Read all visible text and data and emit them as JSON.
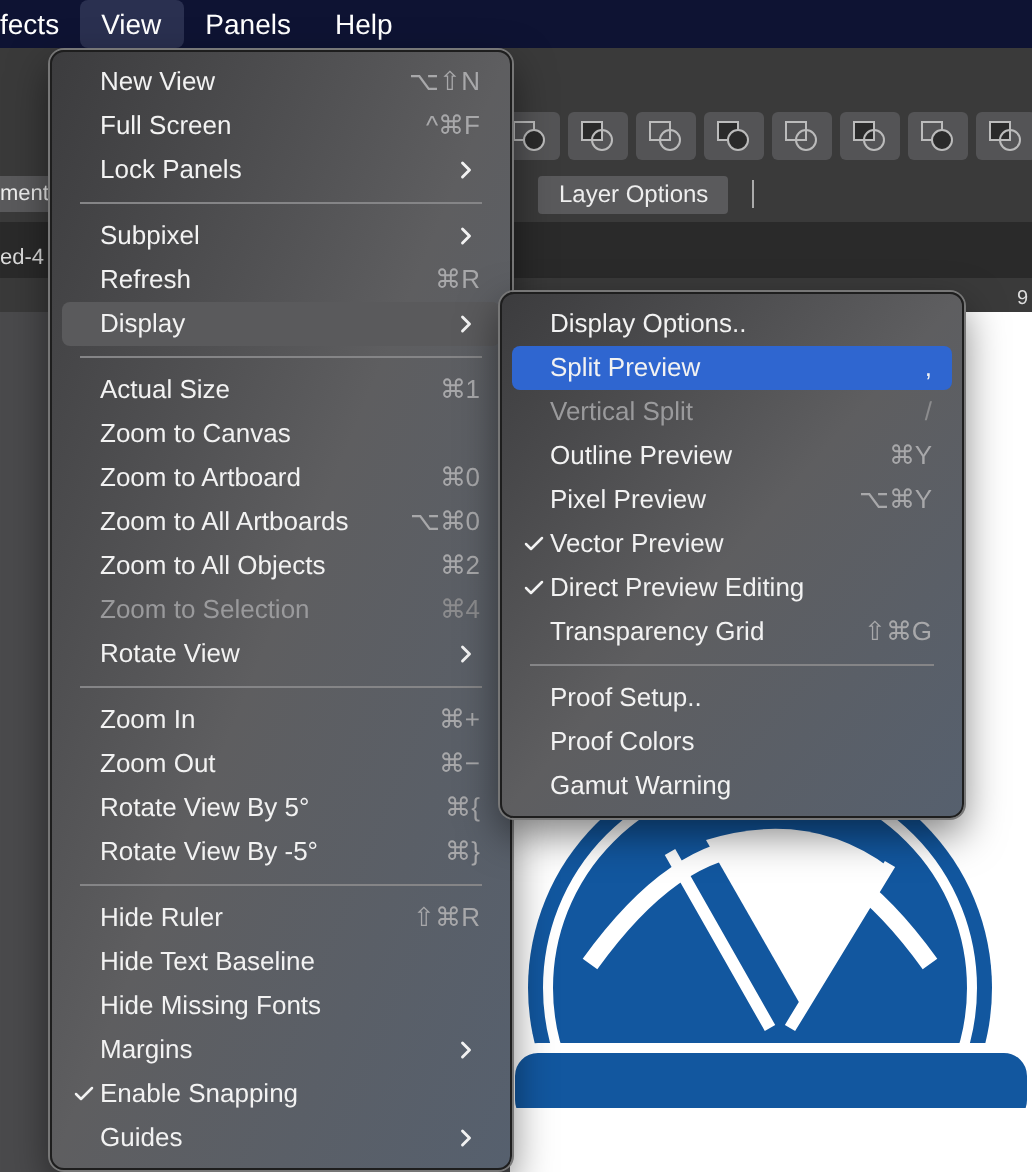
{
  "menu_bar": {
    "items": [
      {
        "label": "fects",
        "selected": false
      },
      {
        "label": "View",
        "selected": true
      },
      {
        "label": "Panels",
        "selected": false
      },
      {
        "label": "Help",
        "selected": false
      }
    ]
  },
  "toolbar": {
    "layer_options_button": "Layer Options",
    "left_tab": "ment",
    "document_tab": "ed-4",
    "ruler_label": "9"
  },
  "view_menu": {
    "groups": [
      [
        {
          "label": "New View",
          "shortcut": "⌥⇧N",
          "submenu": false,
          "checked": false,
          "disabled": false,
          "selected": false
        },
        {
          "label": "Full Screen",
          "shortcut": "^⌘F",
          "submenu": false,
          "checked": false,
          "disabled": false,
          "selected": false
        },
        {
          "label": "Lock Panels",
          "submenu": true,
          "checked": false,
          "disabled": false,
          "selected": false
        }
      ],
      [
        {
          "label": "Subpixel",
          "submenu": true,
          "checked": false,
          "disabled": false,
          "selected": false
        },
        {
          "label": "Refresh",
          "shortcut": "⌘R",
          "submenu": false,
          "checked": false,
          "disabled": false,
          "selected": false
        },
        {
          "label": "Display",
          "submenu": true,
          "checked": false,
          "disabled": false,
          "selected": true
        }
      ],
      [
        {
          "label": "Actual Size",
          "shortcut": "⌘1",
          "submenu": false,
          "checked": false,
          "disabled": false,
          "selected": false
        },
        {
          "label": "Zoom to Canvas",
          "submenu": false,
          "checked": false,
          "disabled": false,
          "selected": false
        },
        {
          "label": "Zoom to Artboard",
          "shortcut": "⌘0",
          "submenu": false,
          "checked": false,
          "disabled": false,
          "selected": false
        },
        {
          "label": "Zoom to All Artboards",
          "shortcut": "⌥⌘0",
          "submenu": false,
          "checked": false,
          "disabled": false,
          "selected": false
        },
        {
          "label": "Zoom to All Objects",
          "shortcut": "⌘2",
          "submenu": false,
          "checked": false,
          "disabled": false,
          "selected": false
        },
        {
          "label": "Zoom to Selection",
          "shortcut": "⌘4",
          "submenu": false,
          "checked": false,
          "disabled": true,
          "selected": false
        },
        {
          "label": "Rotate View",
          "submenu": true,
          "checked": false,
          "disabled": false,
          "selected": false
        }
      ],
      [
        {
          "label": "Zoom In",
          "shortcut": "⌘+",
          "submenu": false,
          "checked": false,
          "disabled": false,
          "selected": false
        },
        {
          "label": "Zoom Out",
          "shortcut": "⌘−",
          "submenu": false,
          "checked": false,
          "disabled": false,
          "selected": false
        },
        {
          "label": "Rotate View By 5°",
          "shortcut": "⌘{",
          "submenu": false,
          "checked": false,
          "disabled": false,
          "selected": false
        },
        {
          "label": "Rotate View By -5°",
          "shortcut": "⌘}",
          "submenu": false,
          "checked": false,
          "disabled": false,
          "selected": false
        }
      ],
      [
        {
          "label": "Hide Ruler",
          "shortcut": "⇧⌘R",
          "submenu": false,
          "checked": false,
          "disabled": false,
          "selected": false
        },
        {
          "label": "Hide Text Baseline",
          "submenu": false,
          "checked": false,
          "disabled": false,
          "selected": false
        },
        {
          "label": "Hide Missing Fonts",
          "submenu": false,
          "checked": false,
          "disabled": false,
          "selected": false
        },
        {
          "label": "Margins",
          "submenu": true,
          "checked": false,
          "disabled": false,
          "selected": false
        },
        {
          "label": "Enable Snapping",
          "submenu": false,
          "checked": true,
          "disabled": false,
          "selected": false
        },
        {
          "label": "Guides",
          "submenu": true,
          "checked": false,
          "disabled": false,
          "selected": false
        }
      ]
    ]
  },
  "display_submenu": {
    "groups": [
      [
        {
          "label": "Display Options..",
          "submenu": false,
          "checked": false,
          "disabled": false,
          "selected": false
        },
        {
          "label": "Split Preview",
          "shortcut": ",",
          "submenu": false,
          "checked": false,
          "disabled": false,
          "selected": true
        },
        {
          "label": "Vertical Split",
          "shortcut": "/",
          "submenu": false,
          "checked": false,
          "disabled": true,
          "selected": false
        },
        {
          "label": "Outline Preview",
          "shortcut": "⌘Y",
          "submenu": false,
          "checked": false,
          "disabled": false,
          "selected": false
        },
        {
          "label": "Pixel Preview",
          "shortcut": "⌥⌘Y",
          "submenu": false,
          "checked": false,
          "disabled": false,
          "selected": false
        },
        {
          "label": "Vector Preview",
          "submenu": false,
          "checked": true,
          "disabled": false,
          "selected": false
        },
        {
          "label": "Direct Preview Editing",
          "submenu": false,
          "checked": true,
          "disabled": false,
          "selected": false
        },
        {
          "label": "Transparency Grid",
          "shortcut": "⇧⌘G",
          "submenu": false,
          "checked": false,
          "disabled": false,
          "selected": false
        }
      ],
      [
        {
          "label": "Proof Setup..",
          "submenu": false,
          "checked": false,
          "disabled": false,
          "selected": false
        },
        {
          "label": "Proof Colors",
          "submenu": false,
          "checked": false,
          "disabled": false,
          "selected": false
        },
        {
          "label": "Gamut Warning",
          "submenu": false,
          "checked": false,
          "disabled": false,
          "selected": false
        }
      ]
    ]
  }
}
